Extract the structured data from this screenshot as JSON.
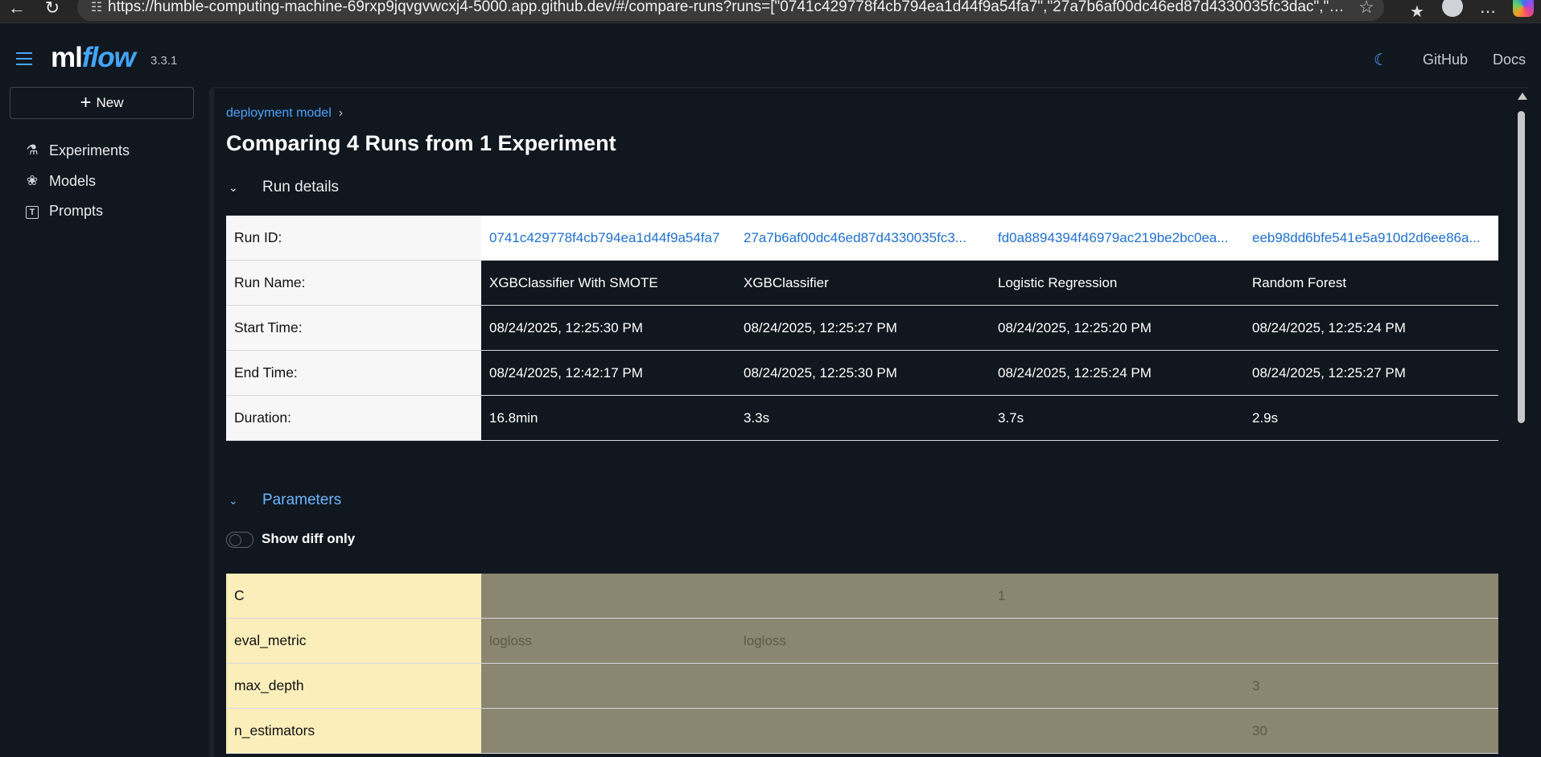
{
  "browser": {
    "url": "https://humble-computing-machine-69rxp9jqvgvwcxj4-5000.app.github.dev/#/compare-runs?runs=[\"0741c429778f4cb794ea1d44f9a54fa7\",\"27a7b6af00dc46ed87d4330035fc3dac\",\"fd0a8894394f46..."
  },
  "header": {
    "logo_ml": "ml",
    "logo_flow": "flow",
    "version": "3.3.1",
    "links": [
      "GitHub",
      "Docs"
    ]
  },
  "sidebar": {
    "new_label": "New",
    "items": [
      {
        "label": "Experiments",
        "icon": "flask-icon"
      },
      {
        "label": "Models",
        "icon": "models-icon"
      },
      {
        "label": "Prompts",
        "icon": "prompts-icon"
      }
    ]
  },
  "main": {
    "breadcrumb": "deployment model",
    "title": "Comparing 4 Runs from 1 Experiment",
    "run_details_label": "Run details",
    "parameters_label": "Parameters",
    "show_diff_label": "Show diff only",
    "run_details": {
      "labels": [
        "Run ID:",
        "Run Name:",
        "Start Time:",
        "End Time:",
        "Duration:"
      ],
      "run_ids": [
        "0741c429778f4cb794ea1d44f9a54fa7",
        "27a7b6af00dc46ed87d4330035fc3...",
        "fd0a8894394f46979ac219be2bc0ea...",
        "eeb98dd6bfe541e5a910d2d6ee86a..."
      ],
      "run_names": [
        "XGBClassifier With SMOTE",
        "XGBClassifier",
        "Logistic Regression",
        "Random Forest"
      ],
      "start_times": [
        "08/24/2025, 12:25:30 PM",
        "08/24/2025, 12:25:27 PM",
        "08/24/2025, 12:25:20 PM",
        "08/24/2025, 12:25:24 PM"
      ],
      "end_times": [
        "08/24/2025, 12:42:17 PM",
        "08/24/2025, 12:25:30 PM",
        "08/24/2025, 12:25:24 PM",
        "08/24/2025, 12:25:27 PM"
      ],
      "durations": [
        "16.8min",
        "3.3s",
        "3.7s",
        "2.9s"
      ]
    },
    "parameters": [
      {
        "name": "C",
        "values": [
          "",
          "",
          "1",
          ""
        ]
      },
      {
        "name": "eval_metric",
        "values": [
          "logloss",
          "logloss",
          "",
          ""
        ]
      },
      {
        "name": "max_depth",
        "values": [
          "",
          "",
          "",
          "3"
        ]
      },
      {
        "name": "n_estimators",
        "values": [
          "",
          "",
          "",
          "30"
        ]
      }
    ]
  }
}
